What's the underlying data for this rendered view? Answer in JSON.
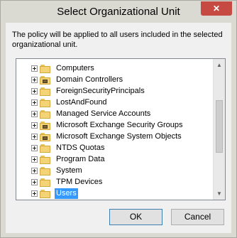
{
  "window": {
    "title": "Select Organizational Unit",
    "close_glyph": "✕"
  },
  "description": "The policy will be applied to all users included in the selected organizational unit.",
  "tree": {
    "selected_index": 12,
    "items": [
      {
        "label": "Computers",
        "icon": "folder-icon"
      },
      {
        "label": "Domain Controllers",
        "icon": "ou-folder-icon"
      },
      {
        "label": "ForeignSecurityPrincipals",
        "icon": "folder-icon"
      },
      {
        "label": "LostAndFound",
        "icon": "folder-icon"
      },
      {
        "label": "Managed Service Accounts",
        "icon": "folder-icon"
      },
      {
        "label": "Microsoft Exchange Security Groups",
        "icon": "ou-folder-icon"
      },
      {
        "label": "Microsoft Exchange System Objects",
        "icon": "ou-folder-icon"
      },
      {
        "label": "NTDS Quotas",
        "icon": "folder-icon"
      },
      {
        "label": "Program Data",
        "icon": "folder-icon"
      },
      {
        "label": "System",
        "icon": "folder-icon"
      },
      {
        "label": "TPM Devices",
        "icon": "folder-icon"
      },
      {
        "label": "Users",
        "icon": "folder-icon"
      }
    ]
  },
  "scrollbar": {
    "up_glyph": "▲",
    "down_glyph": "▼",
    "thumb_position": 0.25,
    "thumb_size": 0.45
  },
  "buttons": {
    "ok_label": "OK",
    "cancel_label": "Cancel"
  },
  "colors": {
    "selection": "#3399ff",
    "close_button": "#c74a42"
  }
}
